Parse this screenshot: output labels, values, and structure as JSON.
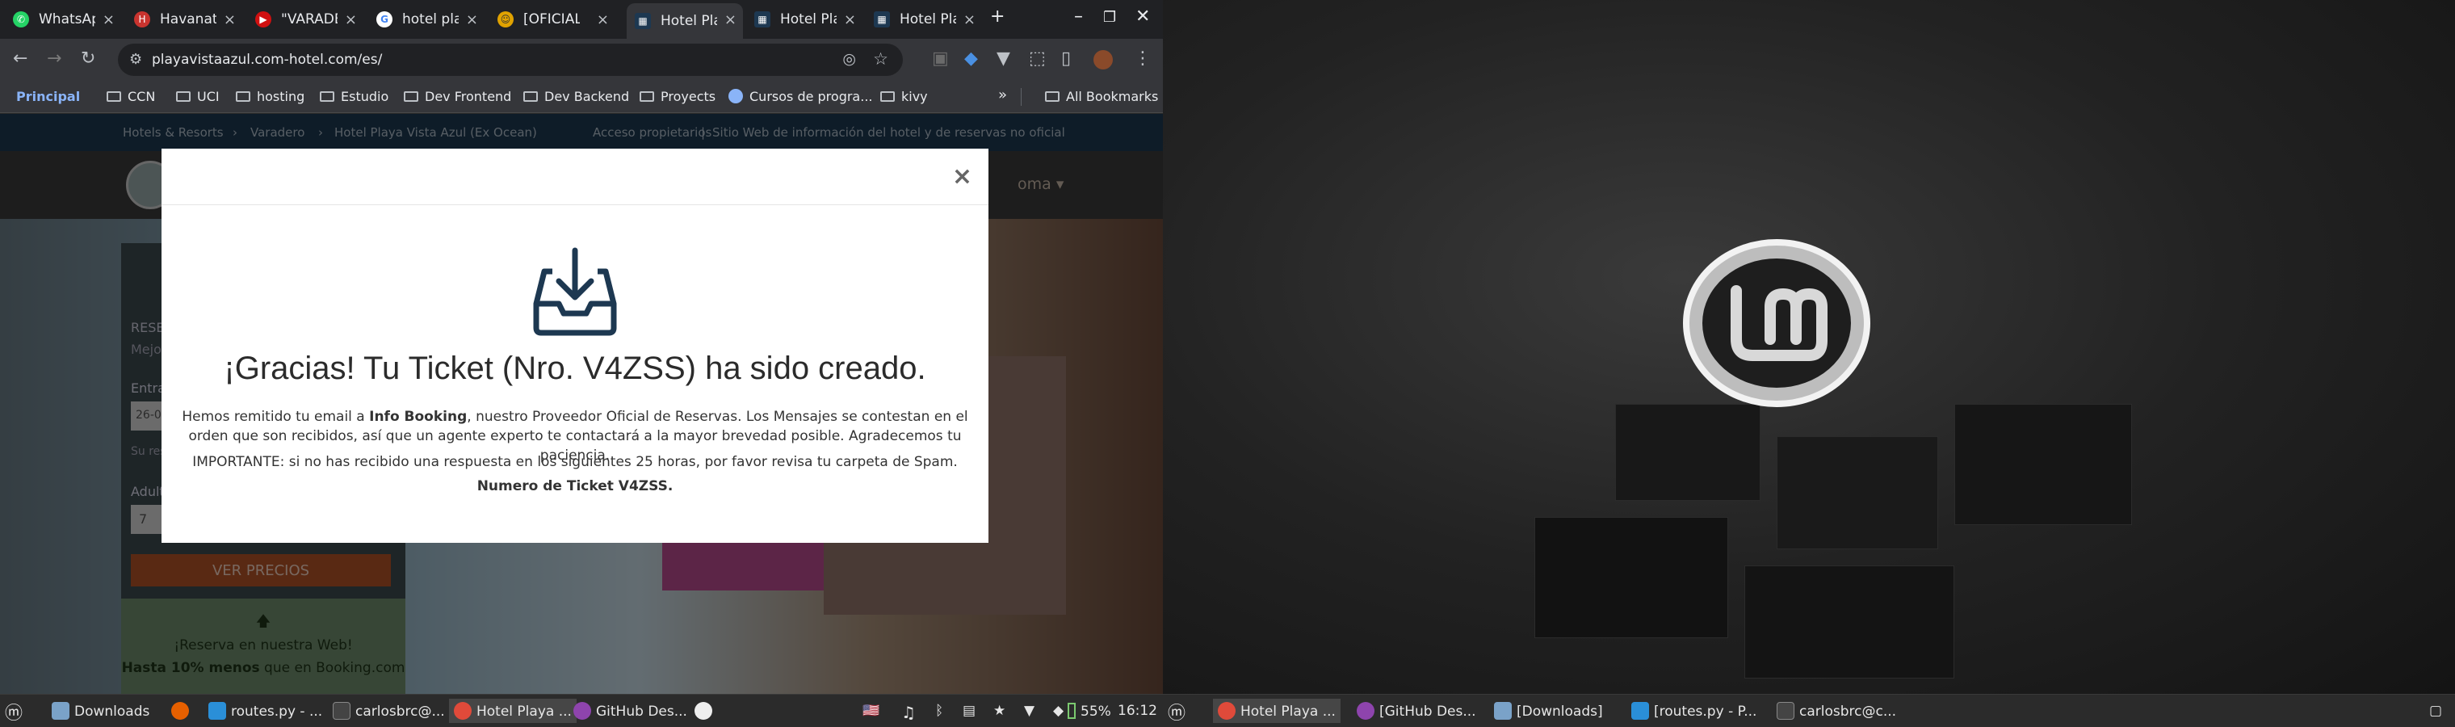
{
  "browser": {
    "tabs": [
      {
        "label": "WhatsApp",
        "color": "#25d366",
        "icon": "whatsapp-icon"
      },
      {
        "label": "Havanatur",
        "color": "#c9342f",
        "icon": "havanatur-icon"
      },
      {
        "label": "\"VARADERO",
        "color": "#d01010",
        "icon": "youtube-icon"
      },
      {
        "label": "hotel playa",
        "color": "#4285f4",
        "icon": "google-icon"
      },
      {
        "label": "[OFICIAL]",
        "color": "#e0a200",
        "icon": "smiley-icon"
      },
      {
        "label": "Hotel Playa",
        "color": "#1d3851",
        "icon": "hotel-icon"
      },
      {
        "label": "Hotel Playa",
        "color": "#1d3851",
        "icon": "hotel-icon"
      },
      {
        "label": "Hotel Playa",
        "color": "#1d3851",
        "icon": "hotel-icon"
      }
    ],
    "active_tab": 5,
    "url": "playavistaazul.com-hotel.com/es/",
    "bookmarks": [
      {
        "label": "Principal"
      },
      {
        "label": "CCN"
      },
      {
        "label": "UCI"
      },
      {
        "label": "hosting"
      },
      {
        "label": "Estudio"
      },
      {
        "label": "Dev Frontend"
      },
      {
        "label": "Dev Backend"
      },
      {
        "label": "Proyects"
      },
      {
        "label": "Cursos de progra..."
      },
      {
        "label": "kivy"
      }
    ],
    "all_bookmarks": "All Bookmarks",
    "more": "»"
  },
  "site": {
    "breadcrumb": [
      "Hotels & Resorts",
      "Varadero",
      "Hotel Playa Vista Azul (Ex Ocean)"
    ],
    "owner_link": "Acceso propietarios",
    "disclaimer": "Sitio Web de información del hotel y de reservas no oficial",
    "idioma": "oma",
    "panel": {
      "reserva": "RESER",
      "mejor": "Mejor",
      "entrada": "Entra",
      "date": "26-0",
      "su": "Su res",
      "adultos": "Adult",
      "adult_value": "7",
      "ver_precios": "VER PRECIOS"
    },
    "promo": {
      "line1": "¡Reserva en nuestra Web!",
      "line2_bold": "Hasta 10% menos",
      "line2_rest": " que en Booking.com"
    }
  },
  "modal": {
    "close": "×",
    "title": "¡Gracias! Tu Ticket (Nro. V4ZSS) ha sido creado.",
    "p1_a": "Hemos remitido tu email a ",
    "p1_bold": "Info Booking",
    "p1_b": ", nuestro Proveedor Oficial de Reservas. Los Mensajes se contestan en el orden que son recibidos, así que un agente experto te contactará a la mayor brevedad posible. Agradecemos tu paciencia.",
    "p2": "IMPORTANTE: si no has recibido una respuesta en los siguientes 25 horas, por favor revisa tu carpeta de Spam.",
    "p3": "Numero de Ticket V4ZSS."
  },
  "taskbar_left": {
    "items": [
      "Downloads",
      "routes.py - ...",
      "carlosbrc@...",
      "Hotel Playa ...",
      "GitHub Des..."
    ],
    "battery": "55%",
    "clock": "16:12"
  },
  "taskbar_right": {
    "items": [
      "Hotel Playa ...",
      "[GitHub Des...",
      "[Downloads]",
      "[routes.py - P...",
      "carlosbrc@c..."
    ]
  },
  "colors": {
    "modal_bg": "#ffffff",
    "site_nav": "#1d3851",
    "cta": "#b35326"
  }
}
